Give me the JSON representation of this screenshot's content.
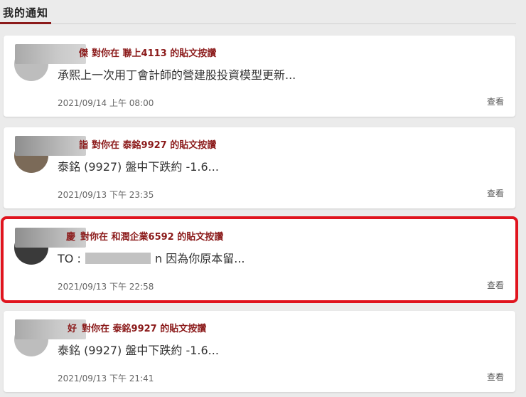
{
  "header": {
    "title": "我的通知"
  },
  "notifications": [
    {
      "name_tail": "傑",
      "action_prefix": "對你在",
      "stock": "聯上4113",
      "action_suffix": "的貼文按讚",
      "content": "承熙上一次用丁會計師的營建股投資模型更新...",
      "time": "2021/09/14 上午 08:00",
      "view_label": "查看"
    },
    {
      "name_tail": "詣",
      "action_prefix": "對你在",
      "stock": "泰銘9927",
      "action_suffix": "的貼文按讚",
      "content": "泰銘 (9927) 盤中下跌約 -1.6...",
      "time": "2021/09/13 下午 23:35",
      "view_label": "查看"
    },
    {
      "name_tail": "慶",
      "action_prefix": "對你在",
      "stock": "和潤企業6592",
      "action_suffix": "的貼文按讚",
      "content_prefix": "TO :",
      "content_suffix": "n 因為你原本留...",
      "time": "2021/09/13 下午 22:58",
      "view_label": "查看"
    },
    {
      "name_tail": "好",
      "action_prefix": "對你在",
      "stock": "泰銘9927",
      "action_suffix": "的貼文按讚",
      "content": "泰銘 (9927) 盤中下跌約 -1.6...",
      "time": "2021/09/13 下午 21:41",
      "view_label": "查看"
    }
  ],
  "colors": {
    "accent": "#8b1a1a",
    "highlight_border": "#e0141e",
    "background": "#ebebeb"
  }
}
